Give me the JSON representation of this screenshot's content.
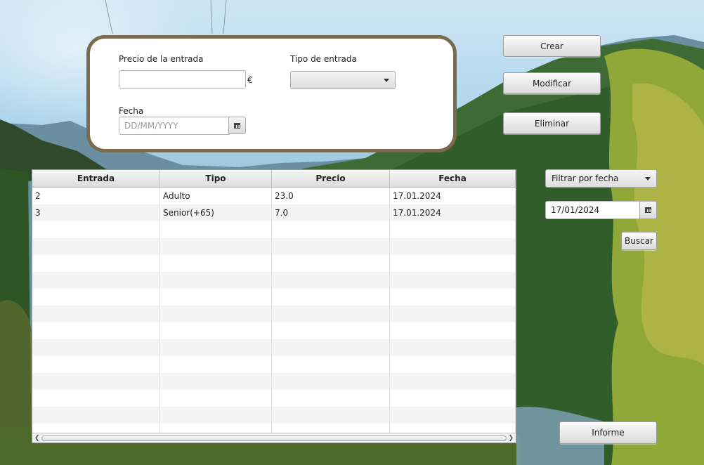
{
  "form": {
    "price_label": "Precio de la entrada",
    "price_value": "",
    "currency": "€",
    "type_label": "Tipo de entrada",
    "type_value": "",
    "date_label": "Fecha",
    "date_placeholder": "DD/MM/YYYY",
    "date_value": ""
  },
  "actions": {
    "create": "Crear",
    "modify": "Modificar",
    "delete": "Eliminar"
  },
  "table": {
    "columns": [
      "Entrada",
      "Tipo",
      "Precio",
      "Fecha"
    ],
    "rows": [
      [
        "2",
        "Adulto",
        "23.0",
        "17.01.2024"
      ],
      [
        "3",
        "Senior(+65)",
        "7.0",
        "17.01.2024"
      ]
    ],
    "empty_rows": 13
  },
  "filter": {
    "mode": "Filtrar por fecha",
    "date_value": "17/01/2024",
    "search": "Buscar"
  },
  "report": "Informe",
  "icons": {
    "combo_arrow": "chevron-down-icon",
    "calendar": "calendar-icon"
  },
  "colors": {
    "panel_border": "#7a6a50"
  }
}
